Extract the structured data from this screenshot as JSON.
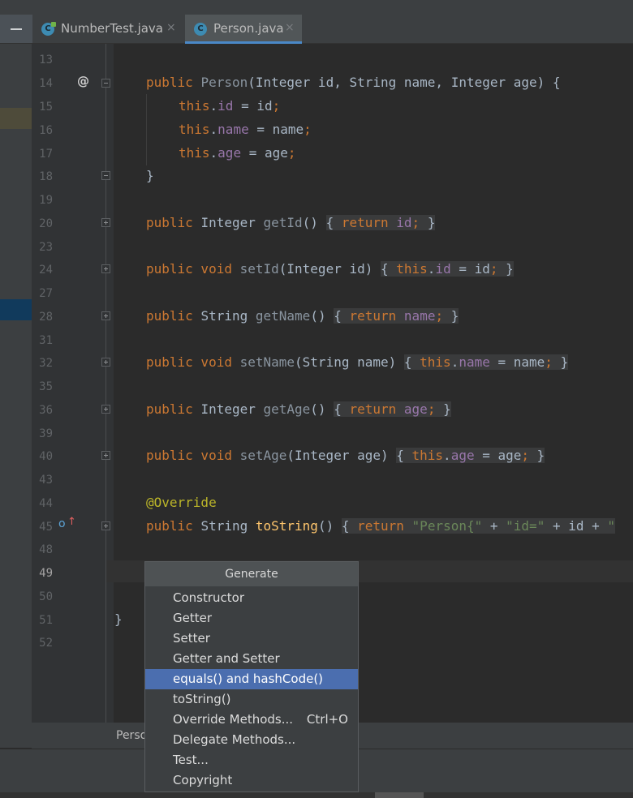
{
  "tabs": [
    {
      "label": "NumberTest.java",
      "close": "×",
      "icon": "C"
    },
    {
      "label": "Person.java",
      "close": "×",
      "icon": "C"
    }
  ],
  "line_numbers": [
    "13",
    "14",
    "15",
    "16",
    "17",
    "18",
    "19",
    "20",
    "23",
    "24",
    "27",
    "28",
    "31",
    "32",
    "35",
    "36",
    "39",
    "40",
    "43",
    "44",
    "45",
    "48",
    "49",
    "50",
    "51",
    "52"
  ],
  "code": {
    "l14_a": "public ",
    "l14_b": "Person",
    "l14_c": "(Integer id, String name, Integer age) {",
    "l15_a": "this",
    "l15_b": ".",
    "l15_c": "id",
    "l15_d": " = id",
    "l15_e": ";",
    "l16_a": "this",
    "l16_b": ".",
    "l16_c": "name",
    "l16_d": " = name",
    "l16_e": ";",
    "l17_a": "this",
    "l17_b": ".",
    "l17_c": "age",
    "l17_d": " = age",
    "l17_e": ";",
    "l18": "}",
    "l20_a": "public ",
    "l20_b": "Integer ",
    "l20_c": "getId",
    "l20_d": "() ",
    "l20_e": "{ ",
    "l20_f": "return ",
    "l20_g": "id",
    "l20_h": "; ",
    "l20_i": "}",
    "l24_a": "public void ",
    "l24_b": "setId",
    "l24_c": "(Integer id) ",
    "l24_d": "{ ",
    "l24_e": "this",
    "l24_f": ".",
    "l24_g": "id",
    "l24_h": " = id",
    "l24_i": "; ",
    "l24_j": "}",
    "l28_a": "public ",
    "l28_b": "String ",
    "l28_c": "getName",
    "l28_d": "() ",
    "l28_e": "{ ",
    "l28_f": "return ",
    "l28_g": "name",
    "l28_h": "; ",
    "l28_i": "}",
    "l32_a": "public void ",
    "l32_b": "setName",
    "l32_c": "(String name) ",
    "l32_d": "{ ",
    "l32_e": "this",
    "l32_f": ".",
    "l32_g": "name",
    "l32_h": " = name",
    "l32_i": "; ",
    "l32_j": "}",
    "l36_a": "public ",
    "l36_b": "Integer ",
    "l36_c": "getAge",
    "l36_d": "() ",
    "l36_e": "{ ",
    "l36_f": "return ",
    "l36_g": "age",
    "l36_h": "; ",
    "l36_i": "}",
    "l40_a": "public void ",
    "l40_b": "setAge",
    "l40_c": "(Integer age) ",
    "l40_d": "{ ",
    "l40_e": "this",
    "l40_f": ".",
    "l40_g": "age",
    "l40_h": " = age",
    "l40_i": "; ",
    "l40_j": "}",
    "l44": "@Override",
    "l45_a": "public ",
    "l45_b": "String ",
    "l45_c": "toString",
    "l45_d": "() ",
    "l45_e": "{ ",
    "l45_f": "return ",
    "l45_g": "\"Person{\"",
    "l45_h": " + ",
    "l45_i": "\"id=\"",
    "l45_j": " + id + ",
    "l45_k": "\"",
    "l51": "}"
  },
  "gutter_icons": {
    "annotation": "@",
    "override": "o",
    "override_arrow": "↑"
  },
  "breadcrumb": "Perso",
  "popup": {
    "title": "Generate",
    "items": [
      {
        "label": "Constructor",
        "shortcut": ""
      },
      {
        "label": "Getter",
        "shortcut": ""
      },
      {
        "label": "Setter",
        "shortcut": ""
      },
      {
        "label": "Getter and Setter",
        "shortcut": ""
      },
      {
        "label": "equals() and hashCode()",
        "shortcut": ""
      },
      {
        "label": "toString()",
        "shortcut": ""
      },
      {
        "label": "Override Methods...",
        "shortcut": "Ctrl+O"
      },
      {
        "label": "Delegate Methods...",
        "shortcut": ""
      },
      {
        "label": "Test...",
        "shortcut": ""
      },
      {
        "label": "Copyright",
        "shortcut": ""
      }
    ],
    "selected_index": 4
  },
  "colors": {
    "keyword": "#cc7832",
    "method": "#ffc66d",
    "field": "#9876aa",
    "string": "#6a8759",
    "annotation": "#bbb529",
    "selection": "#4b6eaf"
  }
}
